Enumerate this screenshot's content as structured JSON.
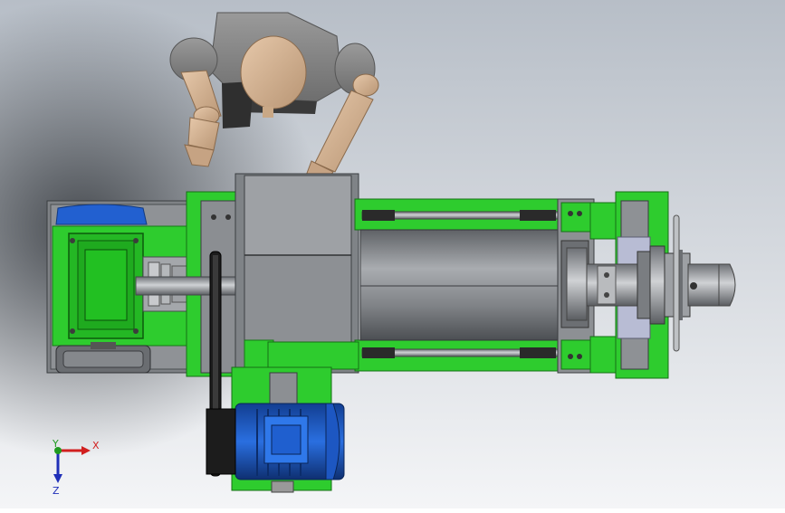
{
  "viewport": {
    "background_top": "#b9c0c8",
    "background_bottom": "#f3f4f6",
    "shadow_color": "#3b3f44"
  },
  "triad": {
    "x_label": "X",
    "y_label": "Y",
    "z_label": "Z",
    "x_color": "#d11f1f",
    "y_color": "#1f9a1f",
    "z_color": "#1f2fb8"
  },
  "model": {
    "frame_color": "#22cc22",
    "metal_color": "#8c8f93",
    "motor_color": "#1f5fcf",
    "gearbox_color": "#1f5fcf",
    "mannequin_color": "#d9b99a",
    "mannequin_shell": "#8b8b8b"
  }
}
